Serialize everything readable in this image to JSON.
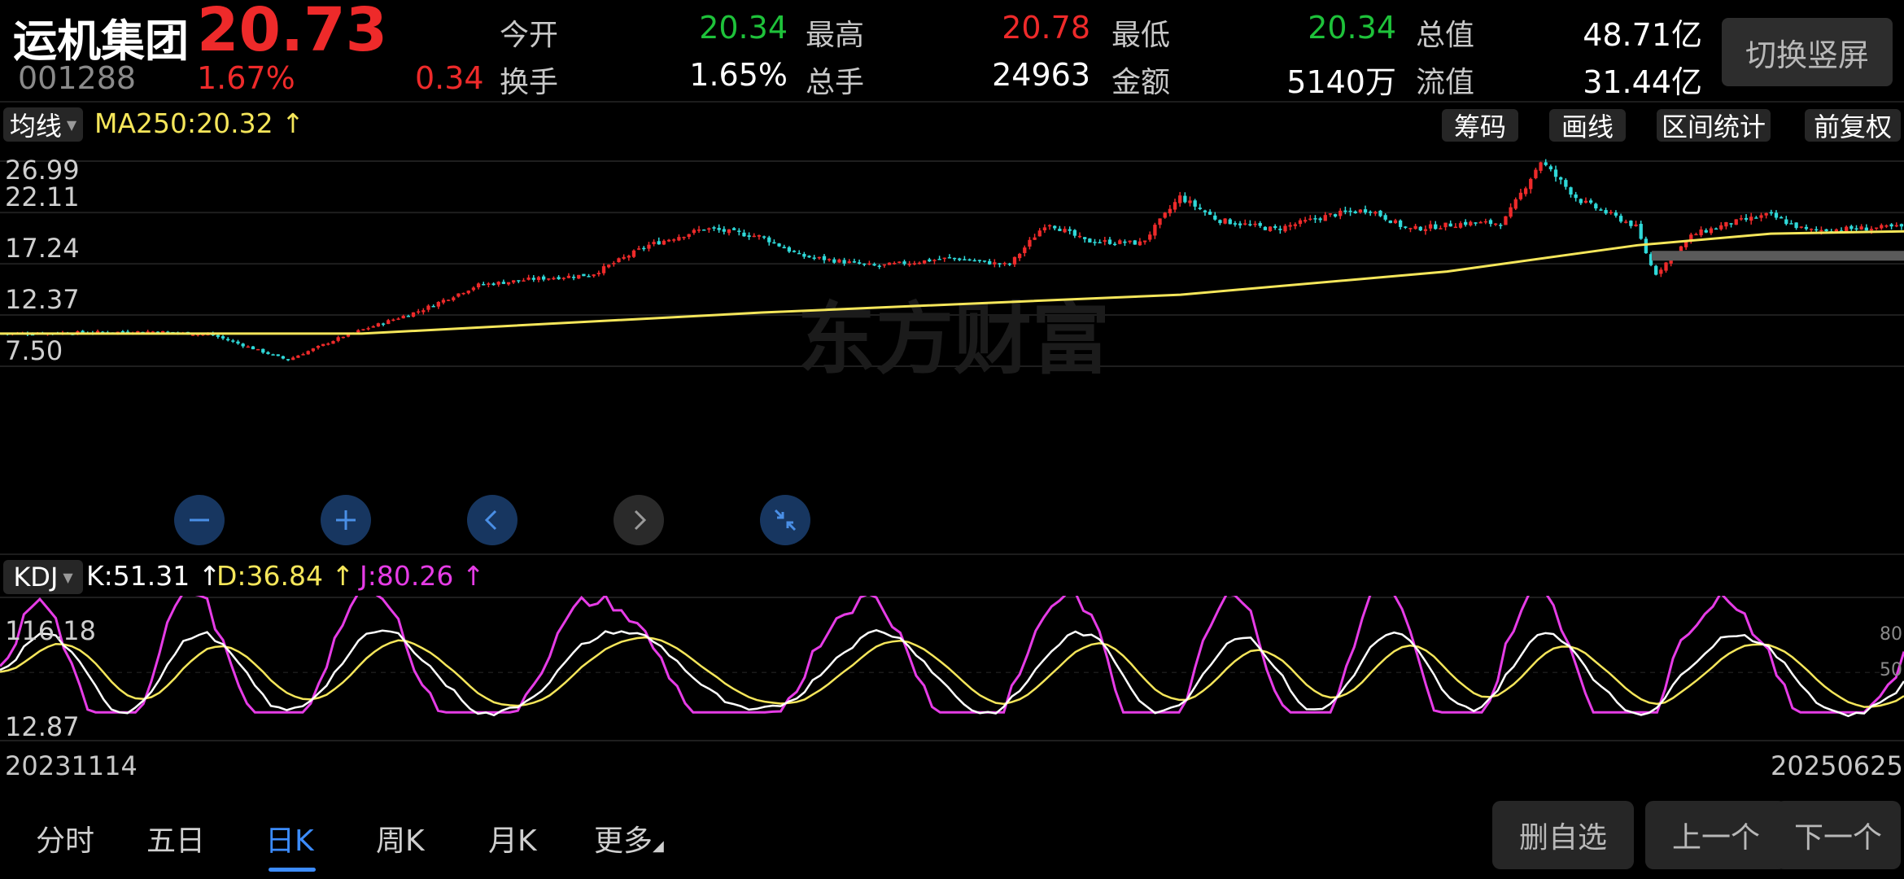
{
  "header": {
    "name": "运机集团",
    "code": "001288",
    "price": "20.73",
    "change_pct": "1.67%",
    "change": "0.34",
    "switch_label": "切换竖屏",
    "stats_row1": [
      {
        "label": "今开",
        "value": "20.34",
        "tone": "green"
      },
      {
        "label": "最高",
        "value": "20.78",
        "tone": "red"
      },
      {
        "label": "最低",
        "value": "20.34",
        "tone": "green"
      },
      {
        "label": "总值",
        "value": "48.71亿",
        "tone": "white"
      }
    ],
    "stats_row2": [
      {
        "label": "换手",
        "value": "1.65%",
        "tone": "white"
      },
      {
        "label": "总手",
        "value": "24963",
        "tone": "white"
      },
      {
        "label": "金额",
        "value": "5140万",
        "tone": "white"
      },
      {
        "label": "流值",
        "value": "31.44亿",
        "tone": "white"
      }
    ]
  },
  "main_toolbar": {
    "indicator": "均线",
    "ma_label": "MA250:20.32 ↑",
    "tools": [
      "筹码",
      "画线",
      "区间统计",
      "前复权"
    ]
  },
  "watermark": "东方财富",
  "kdj_toolbar": {
    "indicator": "KDJ",
    "k": "K:51.31 ↑",
    "d": "D:36.84 ↑",
    "j": "J:80.26 ↑"
  },
  "colors": {
    "up": "#ee2a2a",
    "down": "#2fd9d9",
    "ma": "#f5e65a",
    "k": "#ffffff",
    "d": "#f5e65a",
    "j": "#e63ce6"
  },
  "controls": [
    {
      "name": "zoom-out",
      "icon": "minus-icon"
    },
    {
      "name": "zoom-in",
      "icon": "plus-icon"
    },
    {
      "name": "prev",
      "icon": "chevron-left-icon"
    },
    {
      "name": "next",
      "icon": "chevron-right-icon"
    },
    {
      "name": "collapse",
      "icon": "collapse-icon"
    }
  ],
  "dates": {
    "start": "20231114",
    "end": "20250625"
  },
  "bottom_tabs": [
    "分时",
    "五日",
    "日K",
    "周K",
    "月K",
    "更多"
  ],
  "active_tab": "日K",
  "actions": [
    "删自选",
    "上一个",
    "下一个"
  ],
  "chart_data": [
    {
      "type": "candlestick",
      "title": "日K",
      "x_start": "20231114",
      "x_end": "20250625",
      "ylim": [
        7.5,
        26.99
      ],
      "y_ticks": [
        "26.99",
        "22.11",
        "17.24",
        "12.37",
        "7.50"
      ],
      "grid": true,
      "close_series": [
        [
          0,
          10.6
        ],
        [
          0.04,
          10.7
        ],
        [
          0.08,
          10.8
        ],
        [
          0.11,
          10.5
        ],
        [
          0.15,
          8.1
        ],
        [
          0.18,
          10.4
        ],
        [
          0.22,
          12.8
        ],
        [
          0.25,
          15.2
        ],
        [
          0.28,
          15.8
        ],
        [
          0.31,
          16.2
        ],
        [
          0.34,
          19.0
        ],
        [
          0.37,
          20.6
        ],
        [
          0.4,
          19.8
        ],
        [
          0.42,
          18.0
        ],
        [
          0.46,
          17.0
        ],
        [
          0.5,
          17.8
        ],
        [
          0.53,
          17.1
        ],
        [
          0.55,
          21.2
        ],
        [
          0.57,
          19.4
        ],
        [
          0.6,
          19.2
        ],
        [
          0.62,
          23.6
        ],
        [
          0.64,
          21.4
        ],
        [
          0.67,
          20.5
        ],
        [
          0.7,
          21.9
        ],
        [
          0.72,
          22.4
        ],
        [
          0.74,
          20.5
        ],
        [
          0.77,
          21.1
        ],
        [
          0.79,
          21.1
        ],
        [
          0.81,
          27.0
        ],
        [
          0.83,
          23.3
        ],
        [
          0.86,
          20.8
        ],
        [
          0.87,
          16.2
        ],
        [
          0.89,
          20.0
        ],
        [
          0.91,
          21.1
        ],
        [
          0.93,
          21.9
        ],
        [
          0.95,
          20.4
        ],
        [
          0.98,
          20.6
        ],
        [
          1.0,
          20.73
        ]
      ],
      "ma250": {
        "name": "MA250",
        "value": 20.32,
        "points": [
          [
            0,
            10.6
          ],
          [
            0.19,
            10.6
          ],
          [
            0.4,
            12.6
          ],
          [
            0.62,
            14.3
          ],
          [
            0.76,
            16.5
          ],
          [
            0.86,
            19.0
          ],
          [
            0.93,
            20.1
          ],
          [
            1.0,
            20.32
          ]
        ]
      },
      "marked_level": 18.0
    },
    {
      "type": "line",
      "title": "KDJ",
      "ylim": [
        12.87,
        116.18
      ],
      "y_ticks": [
        "116.18",
        "12.87"
      ],
      "right_ticks": [
        "80",
        "50"
      ],
      "series": [
        {
          "name": "K",
          "value": 51.31
        },
        {
          "name": "D",
          "value": 36.84
        },
        {
          "name": "J",
          "value": 80.26
        }
      ]
    }
  ]
}
